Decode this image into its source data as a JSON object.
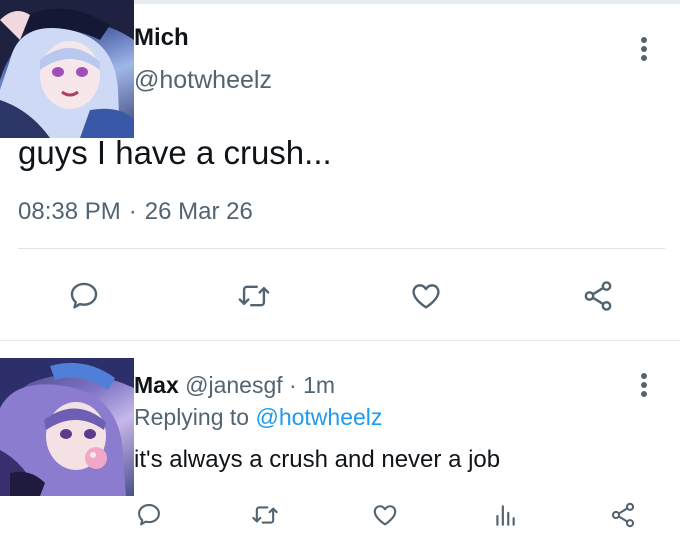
{
  "main_tweet": {
    "name": "Mich",
    "handle": "@hotwheelz",
    "text": "guys I have a crush...",
    "time": "08:38 PM",
    "separator": "·",
    "date": "26 Mar 26"
  },
  "reply": {
    "name": "Max",
    "handle": "@janesgf",
    "separator": "·",
    "age": "1m",
    "replying_prefix": "Replying to",
    "replying_handle": "@hotwheelz",
    "text": "it's always a crush and never a job"
  },
  "icons": {
    "more": "more-vertical-icon",
    "reply": "comment-icon",
    "retweet": "retweet-icon",
    "like": "heart-icon",
    "share": "share-icon",
    "analytics": "analytics-icon"
  },
  "colors": {
    "text": "#0f1419",
    "secondary": "#536471",
    "link": "#1d9bf0",
    "divider": "#dfe5ea"
  }
}
